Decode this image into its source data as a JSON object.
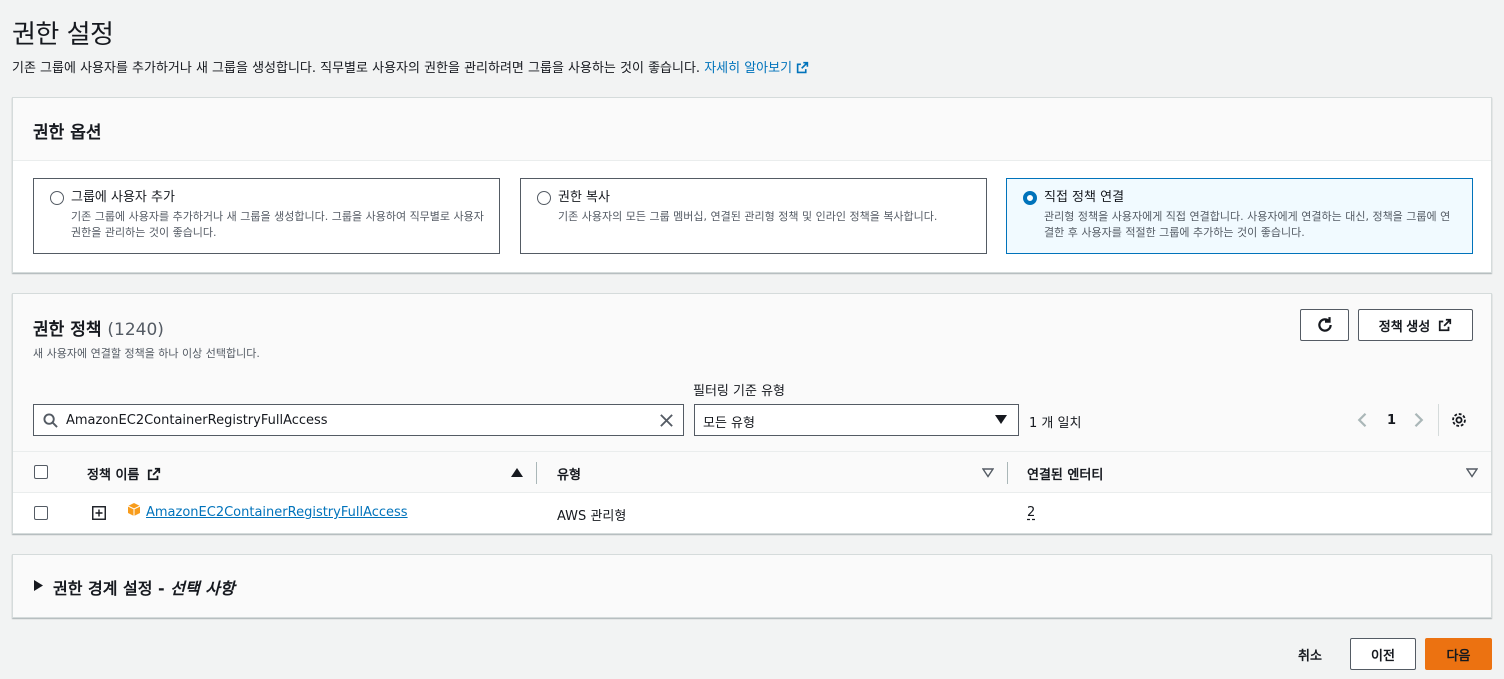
{
  "page": {
    "title": "권한 설정",
    "description": "기존 그룹에 사용자를 추가하거나 새 그룹을 생성합니다. 직무별로 사용자의 권한을 관리하려면 그룹을 사용하는 것이 좋습니다.",
    "learn_more": "자세히 알아보기"
  },
  "options": {
    "title": "권한 옵션",
    "items": [
      {
        "title": "그룹에 사용자 추가",
        "desc": "기존 그룹에 사용자를 추가하거나 새 그룹을 생성합니다. 그룹을 사용하여 직무별로 사용자 권한을 관리하는 것이 좋습니다.",
        "selected": false
      },
      {
        "title": "권한 복사",
        "desc": "기존 사용자의 모든 그룹 멤버십, 연결된 관리형 정책 및 인라인 정책을 복사합니다.",
        "selected": false
      },
      {
        "title": "직접 정책 연결",
        "desc": "관리형 정책을 사용자에게 직접 연결합니다. 사용자에게 연결하는 대신, 정책을 그룹에 연결한 후 사용자를 적절한 그룹에 추가하는 것이 좋습니다.",
        "selected": true
      }
    ]
  },
  "policies": {
    "title": "권한 정책",
    "count": "(1240)",
    "subtitle": "새 사용자에 연결할 정책을 하나 이상 선택합니다.",
    "create_policy_label": "정책 생성",
    "search_value": "AmazonEC2ContainerRegistryFullAccess",
    "filter_label": "필터링 기준 유형",
    "filter_value": "모든 유형",
    "match_text": "1 개 일치",
    "page_number": "1",
    "columns": {
      "name": "정책 이름",
      "type": "유형",
      "entities": "연결된 엔터티"
    },
    "rows": [
      {
        "name": "AmazonEC2ContainerRegistryFullAccess",
        "type": "AWS 관리형",
        "entities": "2"
      }
    ]
  },
  "boundary": {
    "title": "권한 경계 설정 - ",
    "optional": "선택 사항"
  },
  "footer": {
    "cancel": "취소",
    "previous": "이전",
    "next": "다음"
  },
  "colors": {
    "accent": "#0073bb",
    "primary_button": "#ec7211",
    "aws_icon": "#f89c1c"
  }
}
